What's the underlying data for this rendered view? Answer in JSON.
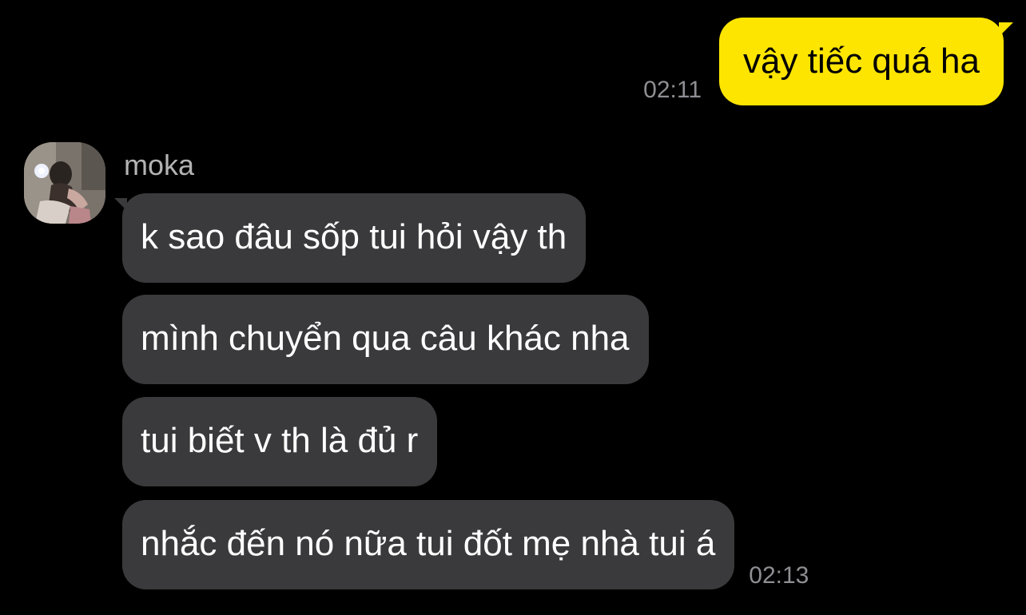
{
  "outgoing": [
    {
      "text": "vậy tiếc quá ha",
      "time": "02:11"
    }
  ],
  "incoming": {
    "sender": "moka",
    "avatar_icon": "avatar-photo",
    "messages": [
      {
        "text": "k sao đâu sốp tui hỏi vậy th"
      },
      {
        "text": "mình chuyển qua câu khác nha"
      },
      {
        "text": "tui biết v th là đủ r"
      },
      {
        "text": "nhắc đến nó nữa tui đốt mẹ nhà tui á",
        "time": "02:13"
      }
    ]
  },
  "colors": {
    "background": "#000000",
    "outgoing_bubble": "#fee500",
    "incoming_bubble": "#3a3a3c",
    "timestamp": "#8e8e93",
    "sender_name": "#b3b3b3"
  }
}
